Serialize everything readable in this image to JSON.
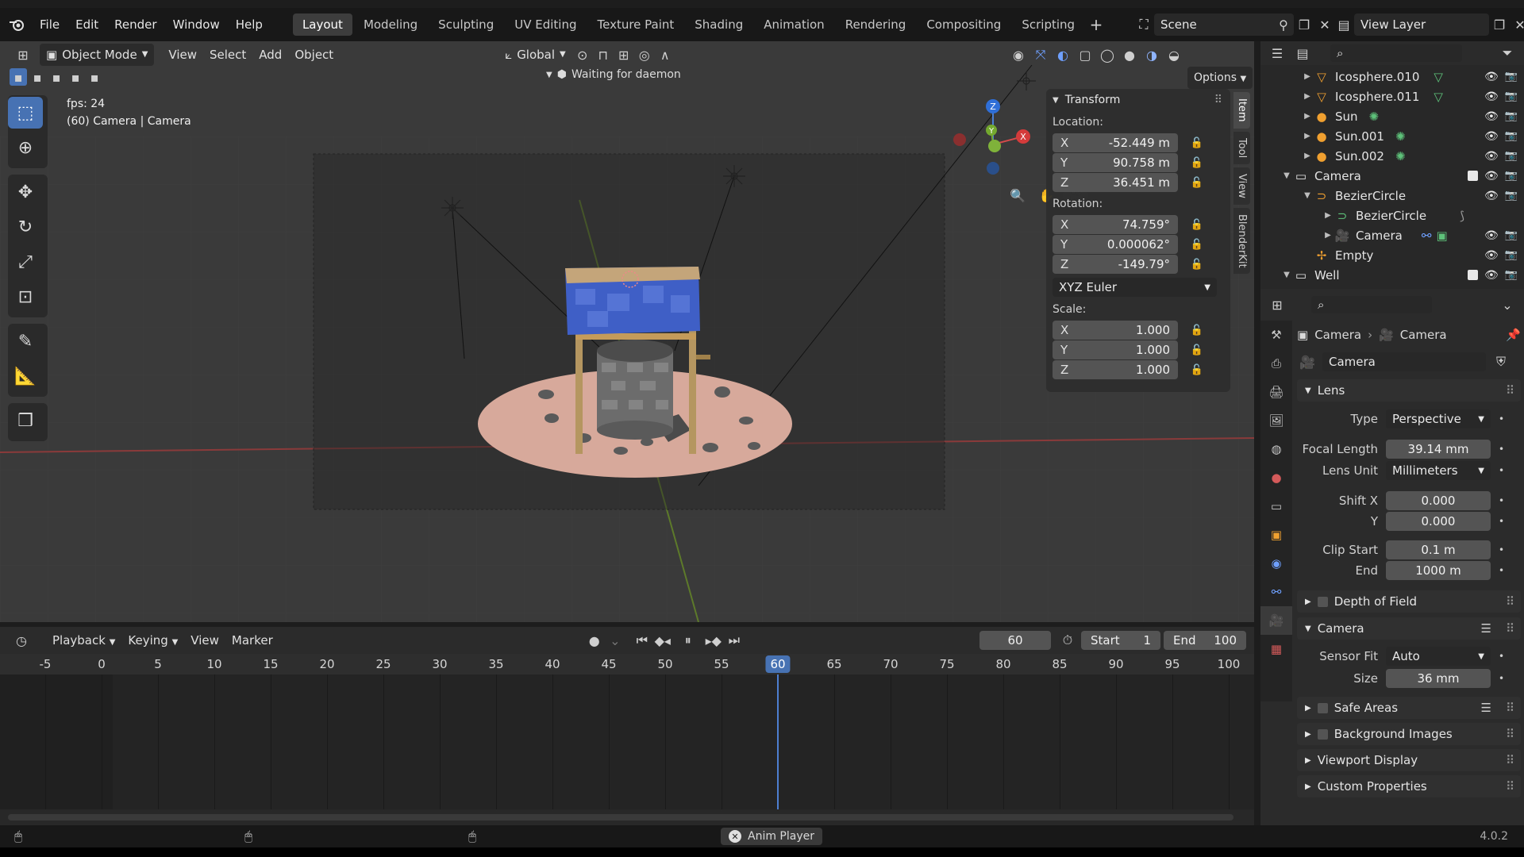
{
  "menu": [
    "File",
    "Edit",
    "Render",
    "Window",
    "Help"
  ],
  "workspaces": [
    "Layout",
    "Modeling",
    "Sculpting",
    "UV Editing",
    "Texture Paint",
    "Shading",
    "Animation",
    "Rendering",
    "Compositing",
    "Scripting"
  ],
  "active_workspace": "Layout",
  "scene": "Scene",
  "view_layer": "View Layer",
  "viewport": {
    "mode": "Object Mode",
    "menus": [
      "View",
      "Select",
      "Add",
      "Object"
    ],
    "orientation": "Global",
    "status": "Waiting for daemon",
    "options": "Options",
    "fps": "fps: 24",
    "camera_info": "(60) Camera | Camera",
    "gizmo": {
      "x": "X",
      "y": "Y",
      "z": "Z"
    }
  },
  "npanel": {
    "title": "Transform",
    "location_label": "Location:",
    "location": [
      {
        "axis": "X",
        "value": "-52.449 m"
      },
      {
        "axis": "Y",
        "value": "90.758 m"
      },
      {
        "axis": "Z",
        "value": "36.451 m"
      }
    ],
    "rotation_label": "Rotation:",
    "rotation": [
      {
        "axis": "X",
        "value": "74.759°"
      },
      {
        "axis": "Y",
        "value": "0.000062°"
      },
      {
        "axis": "Z",
        "value": "-149.79°"
      }
    ],
    "rotation_mode": "XYZ Euler",
    "scale_label": "Scale:",
    "scale": [
      {
        "axis": "X",
        "value": "1.000"
      },
      {
        "axis": "Y",
        "value": "1.000"
      },
      {
        "axis": "Z",
        "value": "1.000"
      }
    ],
    "tabs": [
      "Item",
      "Tool",
      "View",
      "BlenderKit"
    ]
  },
  "outliner": {
    "rows": [
      {
        "name": "Icosphere.010",
        "indent": 1
      },
      {
        "name": "Icosphere.011",
        "indent": 1
      },
      {
        "name": "Sun",
        "indent": 1
      },
      {
        "name": "Sun.001",
        "indent": 1
      },
      {
        "name": "Sun.002",
        "indent": 1
      },
      {
        "name": "Camera",
        "indent": 0
      },
      {
        "name": "BezierCircle",
        "indent": 1
      },
      {
        "name": "BezierCircle",
        "indent": 2
      },
      {
        "name": "Camera",
        "indent": 2
      },
      {
        "name": "Empty",
        "indent": 1
      },
      {
        "name": "Well",
        "indent": 0
      }
    ]
  },
  "properties": {
    "breadcrumb_object": "Camera",
    "breadcrumb_data": "Camera",
    "datablock": "Camera",
    "lens_section": "Lens",
    "type_label": "Type",
    "type_value": "Perspective",
    "focal_label": "Focal Length",
    "focal_value": "39.14 mm",
    "lens_unit_label": "Lens Unit",
    "lens_unit_value": "Millimeters",
    "shift_x_label": "Shift X",
    "shift_x_value": "0.000",
    "shift_y_label": "Y",
    "shift_y_value": "0.000",
    "clip_start_label": "Clip Start",
    "clip_start_value": "0.1 m",
    "clip_end_label": "End",
    "clip_end_value": "1000 m",
    "dof_section": "Depth of Field",
    "camera_section": "Camera",
    "sensor_fit_label": "Sensor Fit",
    "sensor_fit_value": "Auto",
    "size_label": "Size",
    "size_value": "36 mm",
    "safe_areas": "Safe Areas",
    "background_images": "Background Images",
    "viewport_display": "Viewport Display",
    "custom_properties": "Custom Properties"
  },
  "timeline": {
    "menus": [
      "Playback",
      "Keying",
      "View",
      "Marker"
    ],
    "current_frame": "60",
    "start_label": "Start",
    "start": "1",
    "end_label": "End",
    "end": "100",
    "ticks": [
      "-5",
      "0",
      "5",
      "10",
      "15",
      "20",
      "25",
      "30",
      "35",
      "40",
      "45",
      "50",
      "55",
      "60",
      "65",
      "70",
      "75",
      "80",
      "85",
      "90",
      "95",
      "100"
    ],
    "playhead_frame": 60
  },
  "status": {
    "anim_player": "Anim Player",
    "version": "4.0.2"
  }
}
